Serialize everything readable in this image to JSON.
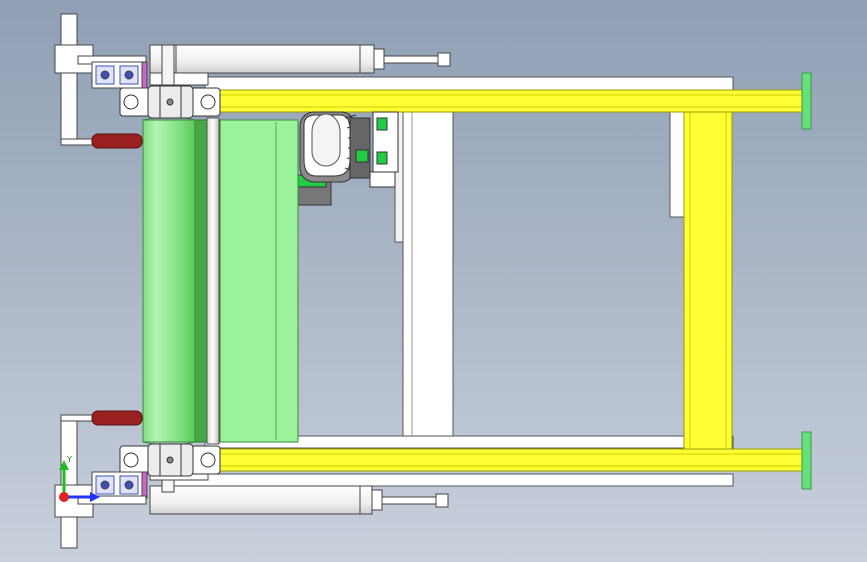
{
  "viewport": {
    "background_top": "#8f9fb4",
    "background_bottom": "#c9d0dc"
  },
  "colors": {
    "frame_yellow": "#ffff33",
    "frame_yellow_edge": "#c8c800",
    "roller_light": "#99ee99",
    "roller_mid": "#66d366",
    "roller_dark": "#3a9a3a",
    "guard_green": "#9af29a",
    "end_plate_green": "#66e07a",
    "handle_red": "#9a2020",
    "profile_blue": "#4050b0",
    "part_white": "#ffffff",
    "part_edge": "#555555"
  },
  "triad": {
    "y_axis_label": "Y",
    "y_axis_color": "#22bb22",
    "x_axis_color": "#2233ff",
    "origin_color": "#dd2222"
  }
}
